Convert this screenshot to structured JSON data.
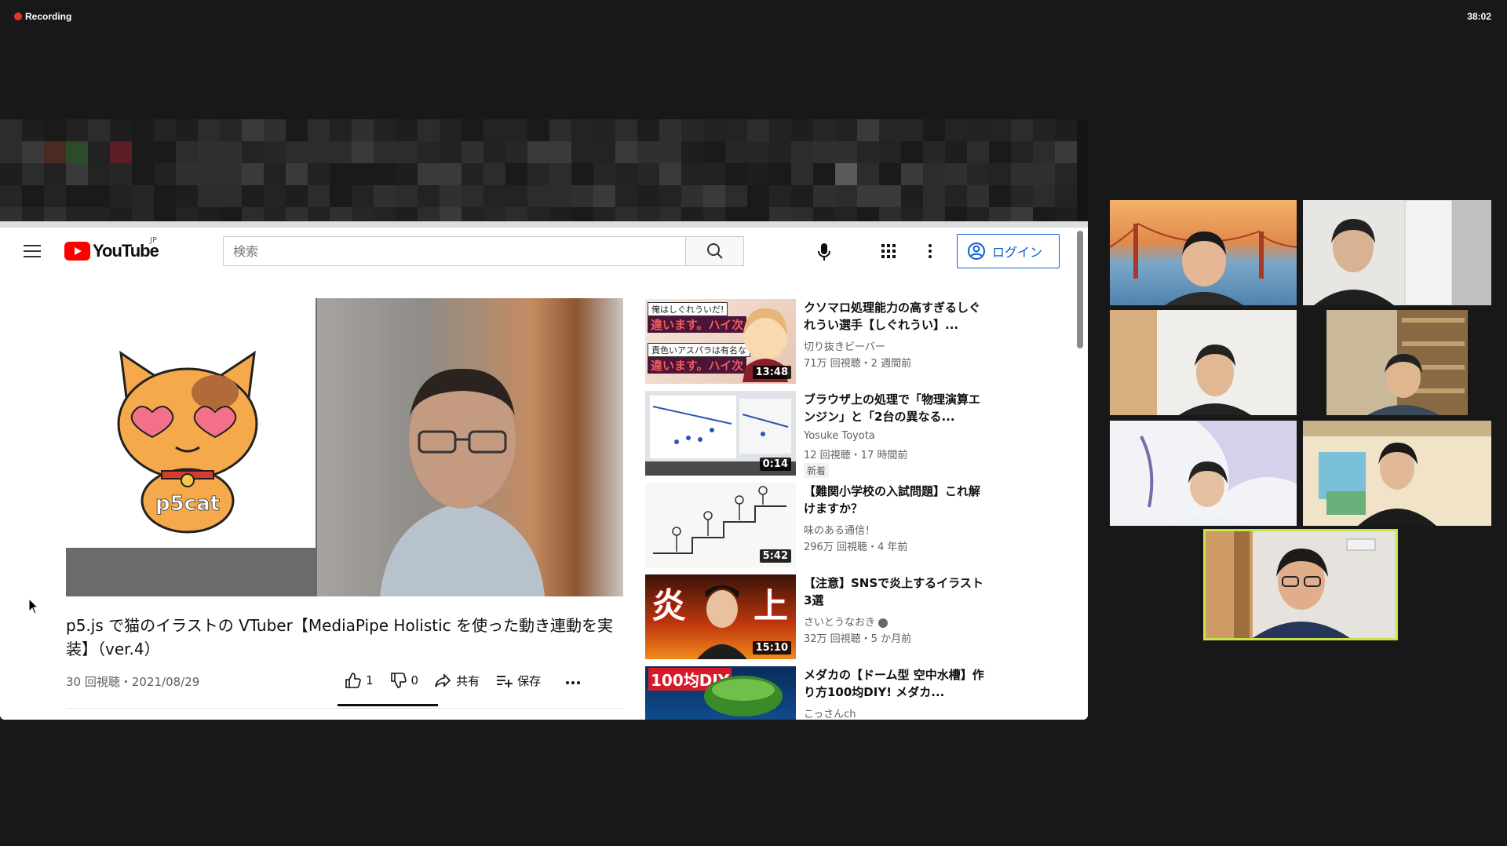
{
  "recording": {
    "label": "Recording",
    "timer": "38:02"
  },
  "youtube": {
    "logo_text": "YouTube",
    "region": "JP",
    "search_placeholder": "検索",
    "login_label": "ログイン",
    "video": {
      "title": "p5.js で猫のイラストの VTuber【MediaPipe Holistic を使った動き連動を実装】（ver.4）",
      "meta": "30 回視聴・2021/08/29",
      "likes": "1",
      "dislikes": "0",
      "share_label": "共有",
      "save_label": "保存",
      "cat_caption": "p5cat"
    },
    "recommendations": [
      {
        "title": "クソマロ処理能力の高すぎるしぐれうい選手【しぐれうい】...",
        "channel": "切り抜きビーバー",
        "views": "71万 回視聴・2 週間前",
        "duration": "13:48",
        "badge": "",
        "thumb_text_1": "俺はしぐれういだ!",
        "thumb_text_2": "違います。ハイ次",
        "thumb_text_3": "責色いアスパラは有名な",
        "thumb_text_4": "違います。ハイ次"
      },
      {
        "title": "ブラウザ上の処理で「物理演算エンジン」と「2台の異なる...",
        "channel": "Yosuke Toyota",
        "views": "12 回視聴・17 時間前",
        "duration": "0:14",
        "badge": "新着"
      },
      {
        "title": "【難関小学校の入試問題】これ解けますか？",
        "channel": "味のある通信！",
        "views": "296万 回視聴・4 年前",
        "duration": "5:42",
        "badge": ""
      },
      {
        "title": "【注意】SNSで炎上するイラスト　3選",
        "channel": "さいとうなおき",
        "views": "32万 回視聴・5 か月前",
        "duration": "15:10",
        "badge": "",
        "thumb_text_1": "炎",
        "thumb_text_2": "上"
      },
      {
        "title": "メダカの【ドーム型 空中水槽】作り方100均DIY! メダカ...",
        "channel": "こっさんch",
        "views": "",
        "duration": "",
        "badge": "",
        "thumb_text_1": "100均DIY"
      }
    ]
  },
  "colors": {
    "recording_dot": "#e5362c",
    "youtube_red": "#ff0000",
    "link_blue": "#065fd4",
    "active_speaker_border": "#c7e34a"
  }
}
